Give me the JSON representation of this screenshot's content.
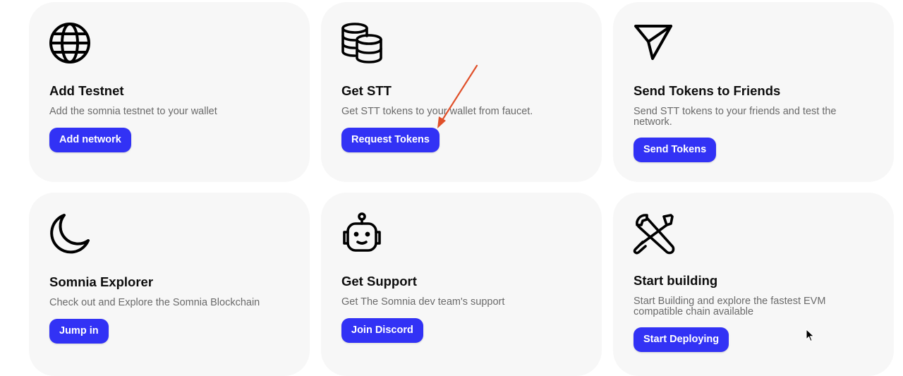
{
  "cards": [
    {
      "id": "add-testnet",
      "icon": "globe-icon",
      "title": "Add Testnet",
      "description": "Add the somnia testnet to your wallet",
      "button_label": "Add network"
    },
    {
      "id": "get-stt",
      "icon": "coins-stack-icon",
      "title": "Get STT",
      "description": "Get STT tokens to your wallet from faucet.",
      "button_label": "Request Tokens"
    },
    {
      "id": "send-tokens",
      "icon": "paper-plane-icon",
      "title": "Send Tokens to Friends",
      "description": "Send STT tokens to your friends and test the network.",
      "button_label": "Send Tokens"
    },
    {
      "id": "somnia-explorer",
      "icon": "moon-icon",
      "title": "Somnia Explorer",
      "description": "Check out and Explore the Somnia Blockchain",
      "button_label": "Jump in"
    },
    {
      "id": "get-support",
      "icon": "robot-icon",
      "title": "Get Support",
      "description": "Get The Somnia dev team's support",
      "button_label": "Join Discord"
    },
    {
      "id": "start-building",
      "icon": "tools-icon",
      "title": "Start building",
      "description": "Start Building and explore the fastest EVM compatible chain available",
      "button_label": "Start Deploying"
    }
  ],
  "colors": {
    "card_background": "#f7f7f7",
    "button_background": "#3232f5",
    "button_text": "#ffffff",
    "title_text": "#0d0d0d",
    "description_text": "#6a6a6a",
    "annotation_arrow": "#e0502a"
  }
}
